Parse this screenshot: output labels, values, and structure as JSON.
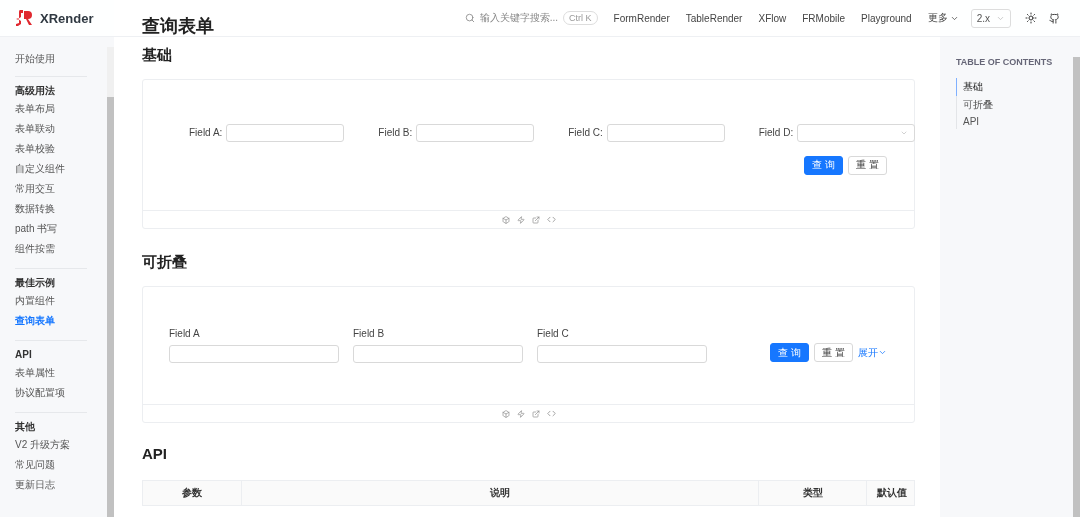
{
  "header": {
    "logo": "XRender",
    "search": {
      "placeholder": "输入关键字搜索...",
      "shortcut": "Ctrl K"
    },
    "nav": [
      "FormRender",
      "TableRender",
      "XFlow",
      "FRMobile",
      "Playground"
    ],
    "more": "更多",
    "version": "2.x"
  },
  "sidebar": {
    "groups": [
      {
        "items": [
          {
            "label": "开始使用",
            "selected": false
          }
        ]
      },
      {
        "title": "高级用法",
        "items": [
          {
            "label": "表单布局",
            "selected": false
          },
          {
            "label": "表单联动",
            "selected": false
          },
          {
            "label": "表单校验",
            "selected": false
          },
          {
            "label": "自定义组件",
            "selected": false
          },
          {
            "label": "常用交互",
            "selected": false
          },
          {
            "label": "数据转换",
            "selected": false
          },
          {
            "label": "path 书写",
            "selected": false
          },
          {
            "label": "组件按需",
            "selected": false
          }
        ]
      },
      {
        "title": "最佳示例",
        "items": [
          {
            "label": "内置组件",
            "selected": false
          },
          {
            "label": "查询表单",
            "selected": true
          }
        ]
      },
      {
        "title": "API",
        "items": [
          {
            "label": "表单属性",
            "selected": false
          },
          {
            "label": "协议配置项",
            "selected": false
          }
        ]
      },
      {
        "title": "其他",
        "items": [
          {
            "label": "V2 升级方案",
            "selected": false
          },
          {
            "label": "常见问题",
            "selected": false
          },
          {
            "label": "更新日志",
            "selected": false
          }
        ]
      }
    ]
  },
  "page_title": "查询表单",
  "sections": [
    {
      "title": "基础",
      "kind": "inline",
      "fields": [
        {
          "label": "Field A:",
          "kind": "input"
        },
        {
          "label": "Field B:",
          "kind": "input"
        },
        {
          "label": "Field C:",
          "kind": "input"
        },
        {
          "label": "Field D:",
          "kind": "select"
        }
      ],
      "submit": "查 询",
      "reset": "重 置"
    },
    {
      "title": "可折叠",
      "kind": "vertical",
      "fields": [
        {
          "label": "Field A",
          "kind": "input"
        },
        {
          "label": "Field B",
          "kind": "input"
        },
        {
          "label": "Field C",
          "kind": "input"
        }
      ],
      "submit": "查 询",
      "reset": "重 置",
      "expand": "展开"
    }
  ],
  "api": {
    "title": "API",
    "columns": [
      "参数",
      "说明",
      "类型",
      "默认值"
    ]
  },
  "toc": {
    "title": "TABLE OF CONTENTS",
    "items": [
      {
        "label": "基础",
        "selected": true
      },
      {
        "label": "可折叠",
        "selected": false
      },
      {
        "label": "API",
        "selected": false
      }
    ]
  }
}
